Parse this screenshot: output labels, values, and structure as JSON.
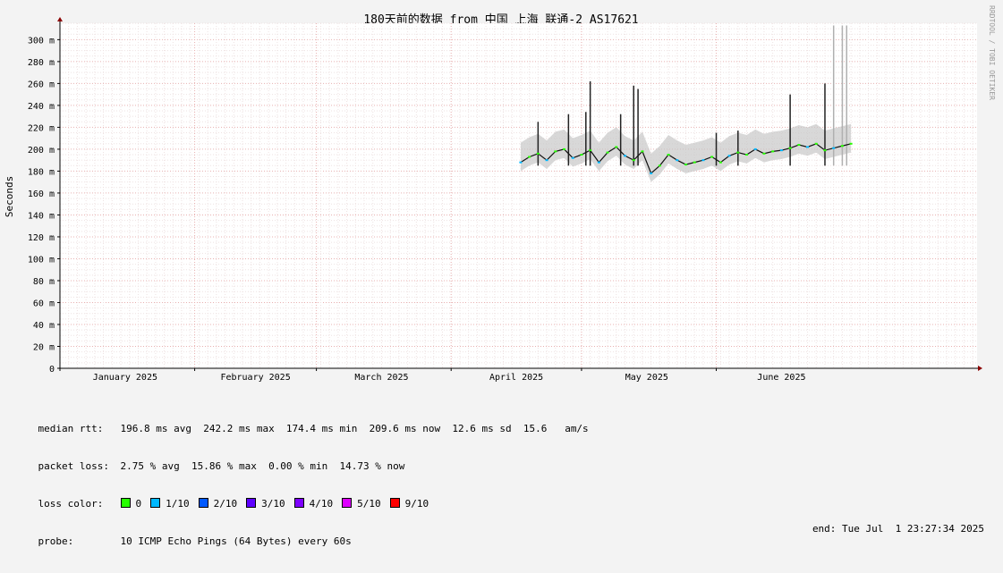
{
  "title": "180天前的数据 from 中国 上海 联通-2 AS17621",
  "watermark": "RRDTOOL / TOBI OETIKER",
  "chart_data": {
    "type": "area",
    "title": "180天前的数据 from 中国 上海 联通-2 AS17621",
    "ylabel": "Seconds",
    "ylim": [
      0,
      315
    ],
    "y_ticks": [
      "0",
      "20 m",
      "40 m",
      "60 m",
      "80 m",
      "100 m",
      "120 m",
      "140 m",
      "160 m",
      "180 m",
      "200 m",
      "220 m",
      "240 m",
      "260 m",
      "280 m",
      "300 m"
    ],
    "y_tick_values": [
      0,
      20,
      40,
      60,
      80,
      100,
      120,
      140,
      160,
      180,
      200,
      220,
      240,
      260,
      280,
      300
    ],
    "x_labels": [
      "January 2025",
      "February 2025",
      "March 2025",
      "April 2025",
      "May 2025",
      "June 2025"
    ],
    "x_range_days": [
      0,
      211
    ],
    "x_month_starts_days": [
      0,
      31,
      59,
      90,
      120,
      151
    ],
    "grid": true,
    "median_series": {
      "name": "median rtt",
      "x_days": [
        106,
        108,
        110,
        112,
        114,
        116,
        118,
        120,
        122,
        124,
        126,
        128,
        130,
        132,
        134,
        136,
        138,
        140,
        142,
        144,
        146,
        148,
        150,
        152,
        154,
        156,
        158,
        160,
        162,
        164,
        166,
        168,
        170,
        172,
        174,
        176,
        178,
        180,
        182
      ],
      "values": [
        188,
        193,
        196,
        190,
        198,
        200,
        192,
        195,
        199,
        188,
        197,
        202,
        194,
        190,
        198,
        178,
        185,
        195,
        190,
        186,
        188,
        190,
        193,
        188,
        194,
        197,
        195,
        200,
        196,
        198,
        199,
        201,
        204,
        202,
        205,
        199,
        201,
        203,
        205
      ]
    },
    "spikes": {
      "x_days": [
        110,
        117,
        121,
        122,
        129,
        132,
        133,
        151,
        156,
        168,
        176,
        178,
        180,
        181
      ],
      "values": [
        225,
        232,
        234,
        262,
        232,
        258,
        255,
        215,
        217,
        250,
        260,
        313,
        313,
        313
      ]
    }
  },
  "stats": {
    "median_rtt_label": "median rtt:",
    "median_rtt_values": "196.8 ms avg  242.2 ms max  174.4 ms min  209.6 ms now  12.6 ms sd  15.6   am/s",
    "packet_loss_label": "packet loss:",
    "packet_loss_values": "2.75 % avg  15.86 % max  0.00 % min  14.73 % now",
    "loss_color_label": "loss color:",
    "loss_colors": [
      {
        "label": "0",
        "color": "#26ff00"
      },
      {
        "label": "1/10",
        "color": "#00b8ff"
      },
      {
        "label": "2/10",
        "color": "#0059ff"
      },
      {
        "label": "3/10",
        "color": "#5e00ff"
      },
      {
        "label": "4/10",
        "color": "#7e00ff"
      },
      {
        "label": "5/10",
        "color": "#dd00ff"
      },
      {
        "label": "9/10",
        "color": "#ff0000"
      }
    ],
    "probe_label": "probe:",
    "probe_value": "10 ICMP Echo Pings (64 Bytes) every 60s",
    "end_label": "end: Tue Jul  1 23:27:34 2025"
  }
}
